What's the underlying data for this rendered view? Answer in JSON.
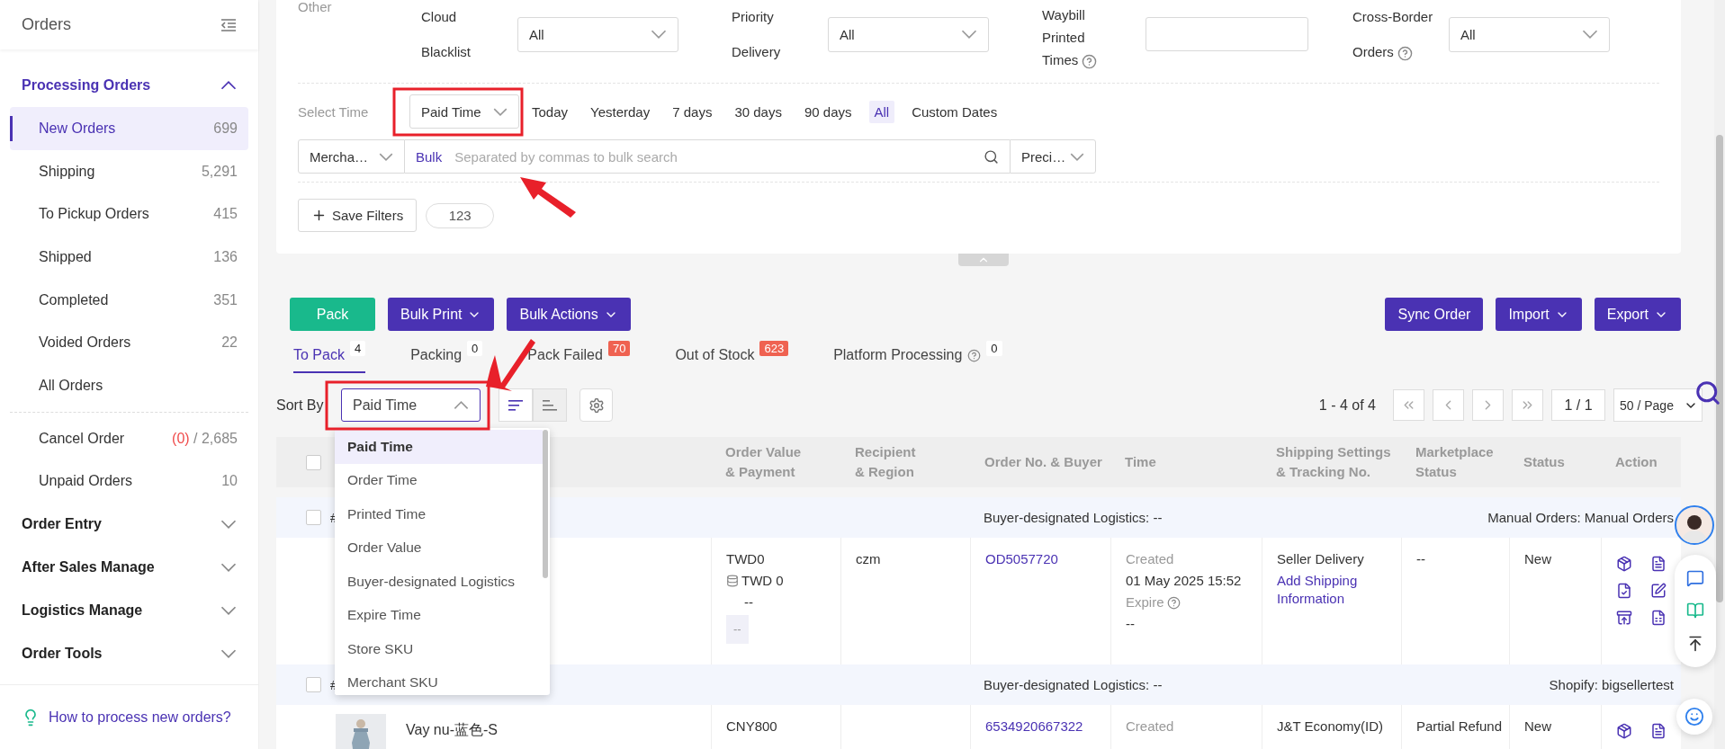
{
  "sidebar": {
    "title": "Orders",
    "sections": [
      {
        "label": "Processing Orders",
        "expanded": true,
        "groups": [
          {
            "items": [
              {
                "label": "New Orders",
                "count": "699",
                "selected": true
              },
              {
                "label": "Shipping",
                "count": "5,291",
                "selected": false
              },
              {
                "label": "To Pickup Orders",
                "count": "415",
                "selected": false
              },
              {
                "label": "Shipped",
                "count": "136",
                "selected": false
              },
              {
                "label": "Completed",
                "count": "351",
                "selected": false
              },
              {
                "label": "Voided Orders",
                "count": "22",
                "selected": false
              },
              {
                "label": "All Orders",
                "selected": false
              }
            ]
          },
          {
            "items": [
              {
                "label": "Cancel Order",
                "alert": "(0)",
                "count": "/ 2,685",
                "selected": false
              },
              {
                "label": "Unpaid Orders",
                "count": "10",
                "selected": false
              }
            ]
          }
        ]
      },
      {
        "label": "Order Entry",
        "expanded": false
      },
      {
        "label": "After Sales Manage",
        "expanded": false
      },
      {
        "label": "Logistics Manage",
        "expanded": false
      },
      {
        "label": "Order Tools",
        "expanded": false
      }
    ],
    "help_link": "How to process new orders?"
  },
  "filters": {
    "group_label": "Other",
    "fields": [
      {
        "label": "Cloud Blacklist",
        "kind": "select",
        "value": "All",
        "help": false
      },
      {
        "label": "Priority Delivery",
        "kind": "select",
        "value": "All",
        "help": false
      },
      {
        "label": "Waybill Printed Times",
        "kind": "input",
        "help": true
      },
      {
        "label": "Cross-Border Orders",
        "kind": "select",
        "value": "All",
        "help": true
      }
    ],
    "time": {
      "label": "Select Time",
      "field": "Paid Time",
      "options": [
        {
          "label": "Today",
          "selected": false
        },
        {
          "label": "Yesterday",
          "selected": false
        },
        {
          "label": "7 days",
          "selected": false
        },
        {
          "label": "30 days",
          "selected": false
        },
        {
          "label": "90 days",
          "selected": false
        },
        {
          "label": "All",
          "selected": true
        },
        {
          "label": "Custom Dates",
          "selected": false
        }
      ]
    },
    "search": {
      "scope": "Mercha…",
      "prefix": "Bulk",
      "placeholder": "Separated by commas to bulk search",
      "match": "Preci…"
    },
    "save_filters": "Save Filters",
    "saved": [
      "123"
    ]
  },
  "toolbar": {
    "left": [
      {
        "label": "Pack",
        "kind": "success"
      },
      {
        "label": "Bulk Print",
        "kind": "menu"
      },
      {
        "label": "Bulk Actions",
        "kind": "menu"
      }
    ],
    "right": [
      {
        "label": "Sync Order",
        "kind": "action"
      },
      {
        "label": "Import",
        "kind": "menu"
      },
      {
        "label": "Export",
        "kind": "menu"
      }
    ]
  },
  "tabs": [
    {
      "label": "To Pack",
      "count": "4",
      "alert": false,
      "help": false,
      "selected": true
    },
    {
      "label": "Packing",
      "count": "0",
      "alert": false,
      "help": false,
      "selected": false
    },
    {
      "label": "Pack Failed",
      "count": "70",
      "alert": true,
      "help": false,
      "selected": false
    },
    {
      "label": "Out of Stock",
      "count": "623",
      "alert": true,
      "help": false,
      "selected": false
    },
    {
      "label": "Platform Processing",
      "count": "0",
      "alert": false,
      "help": true,
      "selected": false
    }
  ],
  "sort": {
    "label": "Sort By",
    "value": "Paid Time",
    "open": true,
    "descending": true,
    "options": [
      {
        "label": "Paid Time",
        "selected": true
      },
      {
        "label": "Order Time",
        "selected": false
      },
      {
        "label": "Printed Time",
        "selected": false
      },
      {
        "label": "Order Value",
        "selected": false
      },
      {
        "label": "Buyer-designated Logistics",
        "selected": false
      },
      {
        "label": "Expire Time",
        "selected": false
      },
      {
        "label": "Store SKU",
        "selected": false
      },
      {
        "label": "Merchant SKU",
        "selected": false
      }
    ]
  },
  "pagination": {
    "range": "1 - 4 of 4",
    "page": "1 / 1",
    "page_size": "50 / Page"
  },
  "table": {
    "select_all": {
      "checked": false
    },
    "columns": [
      "Order Value\n& Payment",
      "Recipient\n& Region",
      "Order No. & Buyer",
      "Time",
      "Shipping Settings\n& Tracking No.",
      "Marketplace\nStatus",
      "Status",
      "Action"
    ],
    "groups": [
      {
        "checked": false,
        "mark": "#",
        "logistics": "Buyer-designated Logistics: --",
        "store": "Manual Orders: Manual Orders",
        "order": {
          "payment": {
            "amount": "TWD0",
            "paid": "TWD 0",
            "sub": "--",
            "tag": "--"
          },
          "recipient": "czm",
          "order_no": "OD5057720",
          "time": {
            "created_label": "Created",
            "created": "01 May 2025 15:52",
            "expire_label": "Expire",
            "expire": "--"
          },
          "shipping": {
            "method": "Seller Delivery",
            "link": "Add Shipping Information"
          },
          "marketplace_status": "--",
          "status": "New"
        }
      },
      {
        "checked": false,
        "mark": "#",
        "logistics": "Buyer-designated Logistics: --",
        "store": "Shopify: bigsellertest",
        "order": {
          "item": {
            "kind": "picture",
            "title": "Vay nu-蓝色-S"
          },
          "payment": {
            "amount": "CNY800"
          },
          "order_no": "6534920667322",
          "time": {
            "created_label": "Created"
          },
          "shipping": {
            "method": "J&T Economy(ID)"
          },
          "marketplace_status": "Partial Refund",
          "status": "New"
        }
      }
    ]
  }
}
